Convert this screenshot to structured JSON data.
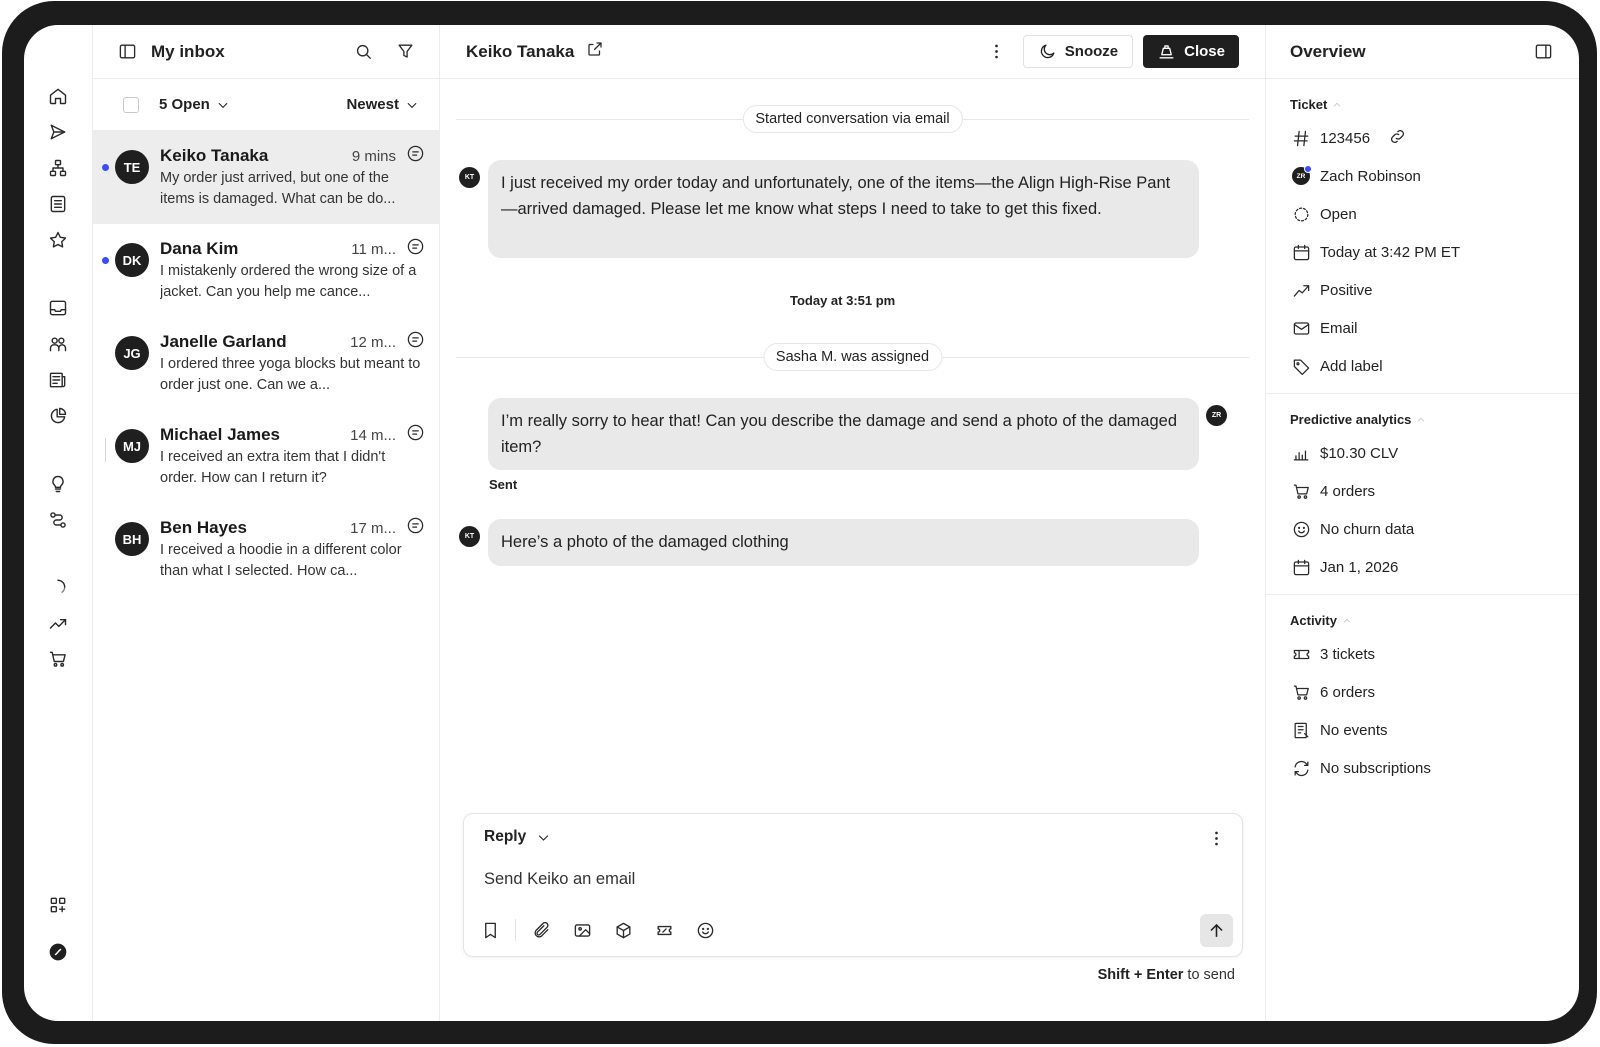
{
  "inbox": {
    "title": "My inbox",
    "filter_label": "5 Open",
    "sort_label": "Newest",
    "conversations": [
      {
        "initials": "TE",
        "name": "Keiko Tanaka",
        "time": "9 mins",
        "preview": "My order just arrived, but one of the items is damaged. What can be do...",
        "unread": true,
        "active": true
      },
      {
        "initials": "DK",
        "name": "Dana Kim",
        "time": "11 m...",
        "preview": "I mistakenly ordered the wrong size of a jacket. Can you help me cance...",
        "unread": true,
        "active": false
      },
      {
        "initials": "JG",
        "name": "Janelle Garland",
        "time": "12 m...",
        "preview": "I ordered three yoga blocks but meant to order just one. Can we a...",
        "unread": false,
        "active": false
      },
      {
        "initials": "MJ",
        "name": "Michael James",
        "time": "14 m...",
        "preview": "I received an extra item that I didn't order. How can I return it?",
        "unread": false,
        "active": false
      },
      {
        "initials": "BH",
        "name": "Ben Hayes",
        "time": "17 m...",
        "preview": "I received a hoodie in a different color than what I selected. How ca...",
        "unread": false,
        "active": false
      }
    ]
  },
  "conversation": {
    "customer_name": "Keiko Tanaka",
    "snooze_label": "Snooze",
    "close_label": "Close",
    "started_label": "Started conversation via email",
    "timestamp_label": "Today at 3:51 pm",
    "assigned_label": "Sasha M. was assigned",
    "sent_label": "Sent",
    "messages": [
      {
        "avatar": "KT",
        "side": "left",
        "text": "I just received my order today and unfortunately, one of the items—the Align High-Rise Pant—arrived damaged. Please let me know what steps I need to take to get this fixed."
      },
      {
        "avatar": "ZR",
        "side": "right",
        "text": "I’m really sorry to hear that! Can you describe the damage and send a photo of the damaged item?"
      },
      {
        "avatar": "KT",
        "side": "left",
        "text": "Here’s a photo of the damaged clothing"
      }
    ]
  },
  "composer": {
    "mode_label": "Reply",
    "placeholder": "Send Keiko an email",
    "hint_keys": "Shift + Enter",
    "hint_suffix": " to send"
  },
  "overview": {
    "title": "Overview",
    "ticket": {
      "title": "Ticket",
      "number": "123456",
      "assignee_initials": "ZR",
      "assignee": "Zach Robinson",
      "status": "Open",
      "created": "Today at 3:42 PM ET",
      "sentiment": "Positive",
      "channel": "Email",
      "add_label": "Add label"
    },
    "predictive": {
      "title": "Predictive analytics",
      "clv": "$10.30 CLV",
      "orders": "4 orders",
      "churn": "No churn data",
      "date": "Jan 1, 2026"
    },
    "activity": {
      "title": "Activity",
      "tickets": "3 tickets",
      "orders": "6 orders",
      "events": "No events",
      "subscriptions": "No subscriptions"
    }
  },
  "colors": {
    "accent_dot": "#3b4bff",
    "dark": "#1f1f1f",
    "active_row": "#ededed",
    "bubble": "#e9e9e9"
  }
}
